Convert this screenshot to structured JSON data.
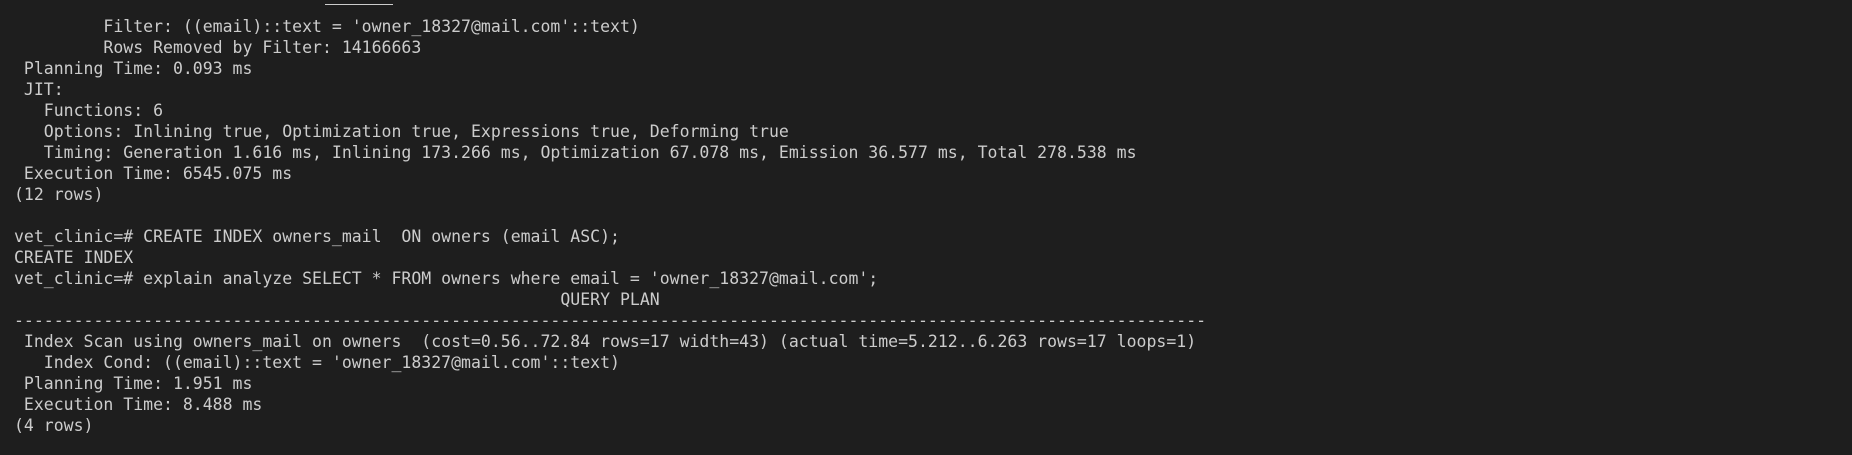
{
  "terminal": {
    "lines": [
      "         Filter: ((email)::text = 'owner_18327@mail.com'::text)",
      "         Rows Removed by Filter: 14166663",
      " Planning Time: 0.093 ms",
      " JIT:",
      "   Functions: 6",
      "   Options: Inlining true, Optimization true, Expressions true, Deforming true",
      "   Timing: Generation 1.616 ms, Inlining 173.266 ms, Optimization 67.078 ms, Emission 36.577 ms, Total 278.538 ms",
      " Execution Time: 6545.075 ms",
      "(12 rows)",
      "",
      "vet_clinic=# CREATE INDEX owners_mail  ON owners (email ASC);",
      "CREATE INDEX",
      "vet_clinic=# explain analyze SELECT * FROM owners where email = 'owner_18327@mail.com';",
      "                                                       QUERY PLAN",
      "------------------------------------------------------------------------------------------------------------------------",
      " Index Scan using owners_mail on owners  (cost=0.56..72.84 rows=17 width=43) (actual time=5.212..6.263 rows=17 loops=1)",
      "   Index Cond: ((email)::text = 'owner_18327@mail.com'::text)",
      " Planning Time: 1.951 ms",
      " Execution Time: 8.488 ms",
      "(4 rows)"
    ]
  }
}
